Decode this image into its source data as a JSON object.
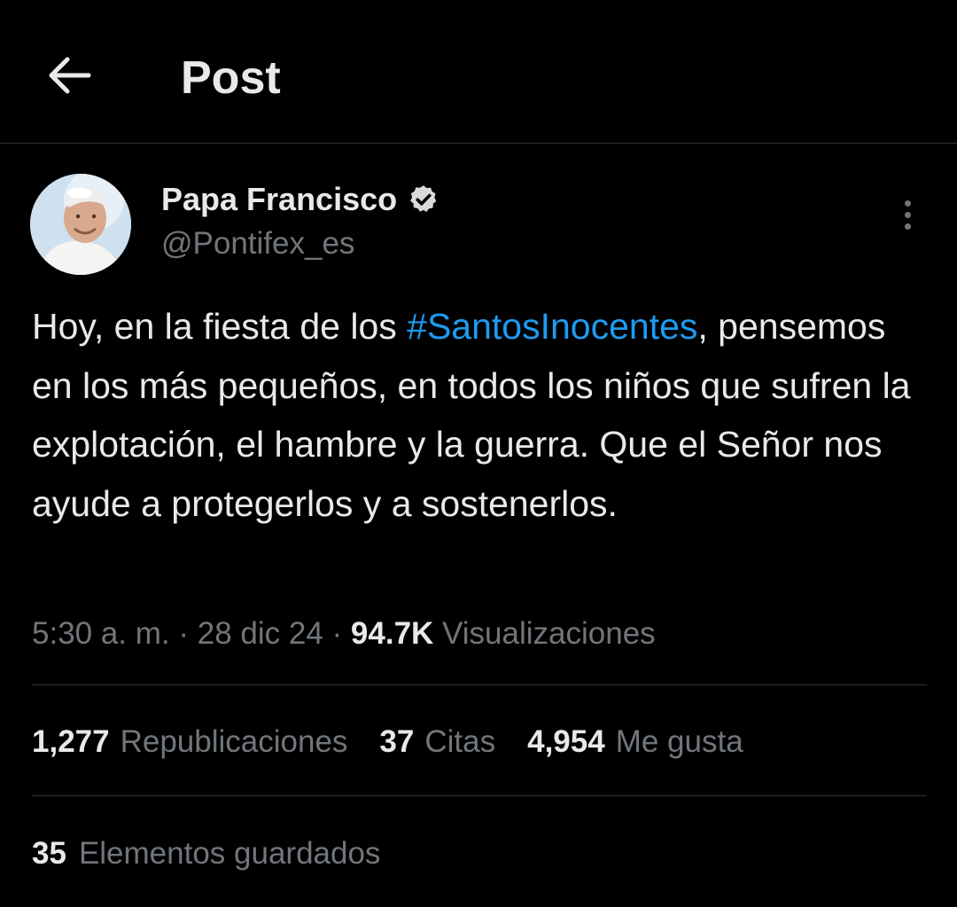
{
  "header": {
    "title": "Post",
    "back_icon": "arrow-left-icon"
  },
  "author": {
    "name": "Papa Francisco",
    "handle": "@Pontifex_es",
    "verified_icon": "verified-badge-icon",
    "more_icon": "more-vertical-icon"
  },
  "post": {
    "text_before": "Hoy, en la fiesta de los ",
    "hashtag": "#SantosInocentes",
    "text_after": ", pensemos en los más pequeños, en todos los niños que sufren la explotación, el hambre y la guerra. Que el Señor nos ayude a protegerlos y a sostenerlos."
  },
  "meta": {
    "time": "5:30 a. m.",
    "sep1": " · ",
    "date": "28 dic 24",
    "sep2": " · ",
    "views_count": "94.7K",
    "views_label": " Visualizaciones"
  },
  "stats": [
    {
      "count": "1,277",
      "label": "Republicaciones"
    },
    {
      "count": "37",
      "label": "Citas"
    },
    {
      "count": "4,954",
      "label": "Me gusta"
    }
  ],
  "saved": {
    "count": "35",
    "label": "Elementos guardados"
  },
  "colors": {
    "background": "#000000",
    "text_primary": "#e7e9ea",
    "text_secondary": "#71767b",
    "accent": "#1d9bf0",
    "divider": "#2f3336"
  }
}
